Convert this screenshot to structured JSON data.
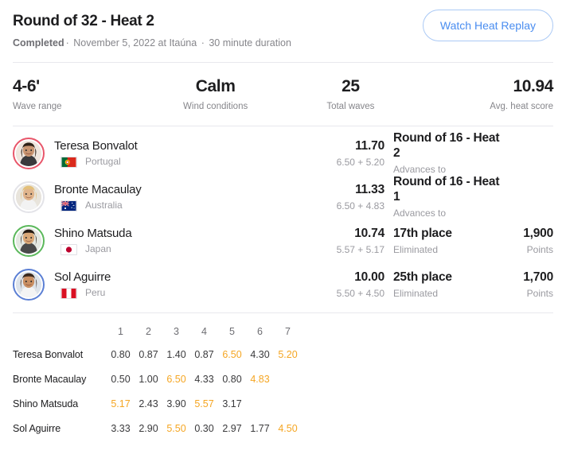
{
  "header": {
    "title": "Round of 32 - Heat 2",
    "status": "Completed",
    "separator": "·",
    "date_location": "November 5, 2022 at Itaúna",
    "duration": "30 minute duration",
    "replay_button": "Watch Heat Replay"
  },
  "stats": [
    {
      "value": "4-6'",
      "label": "Wave range"
    },
    {
      "value": "Calm",
      "label": "Wind conditions"
    },
    {
      "value": "25",
      "label": "Total waves"
    },
    {
      "value": "10.94",
      "label": "Avg. heat score"
    }
  ],
  "athletes": [
    {
      "name": "Teresa Bonvalot",
      "country": "Portugal",
      "flag": "pt",
      "jersey_color": "#e8566a",
      "score": "11.70",
      "score_breakdown": "6.50 + 5.20",
      "result": "Round of 16 - Heat 2",
      "result_sub": "Advances to",
      "points": "",
      "points_label": ""
    },
    {
      "name": "Bronte Macaulay",
      "country": "Australia",
      "flag": "au",
      "jersey_color": "#e3e3e8",
      "score": "11.33",
      "score_breakdown": "6.50 + 4.83",
      "result": "Round of 16 - Heat 1",
      "result_sub": "Advances to",
      "points": "",
      "points_label": ""
    },
    {
      "name": "Shino Matsuda",
      "country": "Japan",
      "flag": "jp",
      "jersey_color": "#5bb85b",
      "score": "10.74",
      "score_breakdown": "5.57 + 5.17",
      "result": "17th place",
      "result_sub": "Eliminated",
      "points": "1,900",
      "points_label": "Points"
    },
    {
      "name": "Sol Aguirre",
      "country": "Peru",
      "flag": "pe",
      "jersey_color": "#5b7fd4",
      "score": "10.00",
      "score_breakdown": "5.50 + 4.50",
      "result": "25th place",
      "result_sub": "Eliminated",
      "points": "1,700",
      "points_label": "Points"
    }
  ],
  "wave_table": {
    "columns": [
      "1",
      "2",
      "3",
      "4",
      "5",
      "6",
      "7"
    ],
    "highlight_color": "#F5A623",
    "rows": [
      {
        "name": "Teresa Bonvalot",
        "scores": [
          "0.80",
          "0.87",
          "1.40",
          "0.87",
          "6.50",
          "4.30",
          "5.20"
        ],
        "highlight": [
          false,
          false,
          false,
          false,
          true,
          false,
          true
        ]
      },
      {
        "name": "Bronte Macaulay",
        "scores": [
          "0.50",
          "1.00",
          "6.50",
          "4.33",
          "0.80",
          "4.83",
          ""
        ],
        "highlight": [
          false,
          false,
          true,
          false,
          false,
          true,
          false
        ]
      },
      {
        "name": "Shino Matsuda",
        "scores": [
          "5.17",
          "2.43",
          "3.90",
          "5.57",
          "3.17",
          "",
          ""
        ],
        "highlight": [
          true,
          false,
          false,
          true,
          false,
          false,
          false
        ]
      },
      {
        "name": "Sol Aguirre",
        "scores": [
          "3.33",
          "2.90",
          "5.50",
          "0.30",
          "2.97",
          "1.77",
          "4.50"
        ],
        "highlight": [
          false,
          false,
          true,
          false,
          false,
          false,
          true
        ]
      }
    ]
  }
}
